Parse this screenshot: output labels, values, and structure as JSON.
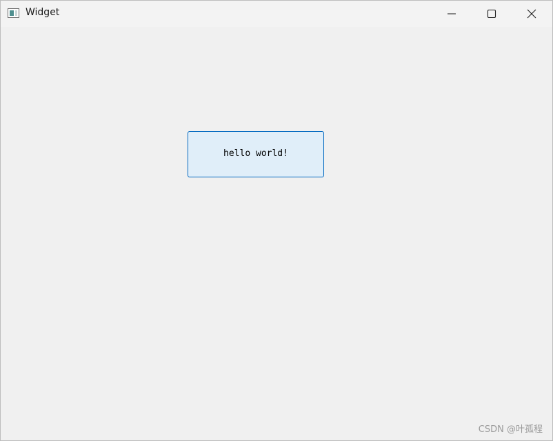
{
  "window": {
    "title": "Widget",
    "app_icon": "window-app-icon"
  },
  "titlebar_buttons": {
    "minimize_icon": "minimize-icon",
    "maximize_icon": "maximize-icon",
    "close_icon": "close-icon"
  },
  "main": {
    "button_label": "hello world!"
  },
  "watermark": {
    "text": "CSDN @叶孤程"
  },
  "colors": {
    "button_border": "#0067c0",
    "button_background": "#e0eef9",
    "window_background": "#f0f0f0"
  }
}
